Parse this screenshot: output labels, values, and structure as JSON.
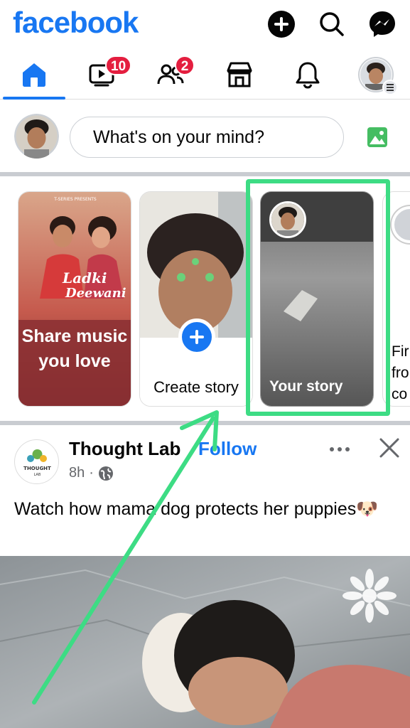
{
  "header": {
    "logo": "facebook",
    "icons": [
      "plus-icon",
      "search-icon",
      "messenger-icon"
    ]
  },
  "nav": {
    "items": [
      {
        "name": "home",
        "icon": "home-icon",
        "active": true
      },
      {
        "name": "video",
        "icon": "video-icon",
        "badge": "10"
      },
      {
        "name": "friends",
        "icon": "friends-icon",
        "badge": "2"
      },
      {
        "name": "marketplace",
        "icon": "marketplace-icon"
      },
      {
        "name": "notifications",
        "icon": "bell-icon"
      },
      {
        "name": "menu",
        "icon": "profile-menu-icon"
      }
    ]
  },
  "composer": {
    "placeholder": "What's on your mind?",
    "photo_icon": "photo-icon"
  },
  "stories": {
    "music": {
      "label": "Share music you love",
      "poster_brand": "T-SERIES PRESENTS",
      "poster_title": "Ladki Deewani"
    },
    "create": {
      "label": "Create story"
    },
    "your": {
      "label": "Your story"
    },
    "partial": {
      "label_lines": [
        "Fir",
        "fro",
        "co"
      ]
    }
  },
  "post": {
    "page_name": "Thought Lab",
    "follow_label": "Follow",
    "time": "8h",
    "separator": "·",
    "logo_text": "THOUGHT",
    "logo_sub": "LAB",
    "caption": "Watch how mama dog protects her puppies🐶"
  },
  "colors": {
    "brand": "#1877f2",
    "badge": "#e41e3f",
    "highlight": "#3ddc84",
    "photo_green": "#45bd62"
  }
}
